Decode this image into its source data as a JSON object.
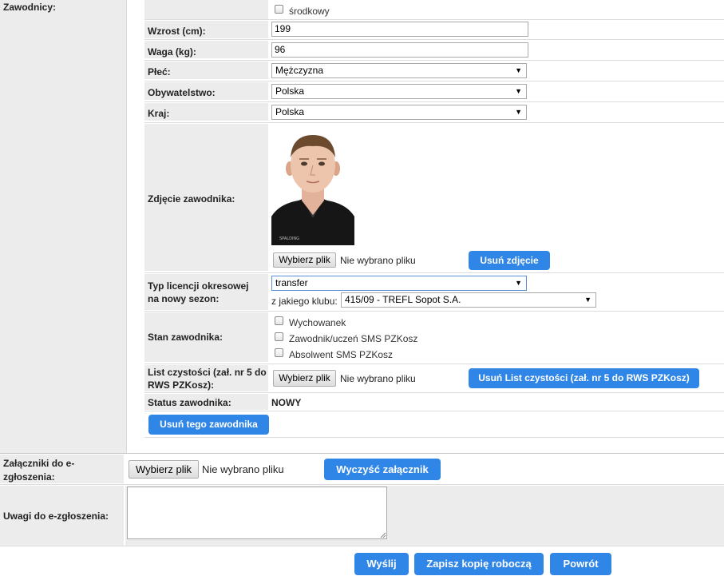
{
  "players_section": {
    "label": "Zawodnicy:"
  },
  "position": {
    "option": "środkowy"
  },
  "height": {
    "label": "Wzrost (cm):",
    "value": "199"
  },
  "weight": {
    "label": "Waga (kg):",
    "value": "96"
  },
  "gender": {
    "label": "Płeć:",
    "value": "Mężczyzna"
  },
  "citizenship": {
    "label": "Obywatelstwo:",
    "value": "Polska"
  },
  "country": {
    "label": "Kraj:",
    "value": "Polska"
  },
  "photo": {
    "label": "Zdjęcie zawodnika:",
    "choose_file": "Wybierz plik",
    "no_file": "Nie wybrano pliku",
    "remove_button": "Usuń zdjęcie",
    "jersey_text": "SPALDING"
  },
  "license": {
    "label_line1": "Typ licencji okresowej",
    "label_line2": "na nowy sezon:",
    "value": "transfer",
    "club_label": "z jakiego klubu:",
    "club_value": "415/09 - TREFL Sopot S.A."
  },
  "player_status_checks": {
    "label": "Stan zawodnika:",
    "options": [
      "Wychowanek",
      "Zawodnik/uczeń SMS PZKosz",
      "Absolwent SMS PZKosz"
    ]
  },
  "clearance_letter": {
    "label_line1": "List czystości (zał. nr 5 do",
    "label_line2": "RWS PZKosz):",
    "choose_file": "Wybierz plik",
    "no_file": "Nie wybrano pliku",
    "remove_button": "Usuń List czystości (zał. nr 5 do RWS PZKosz)"
  },
  "status": {
    "label": "Status zawodnika:",
    "value": "NOWY"
  },
  "remove_player_button": "Usuń tego zawodnika",
  "attachments": {
    "label_line1": "Załączniki do e-",
    "label_line2": "zgłoszenia:",
    "choose_file": "Wybierz plik",
    "no_file": "Nie wybrano pliku",
    "clear_button": "Wyczyść załącznik"
  },
  "remarks": {
    "label": "Uwagi do e-zgłoszenia:",
    "value": ""
  },
  "footer": {
    "send": "Wyślij",
    "save_draft": "Zapisz kopię roboczą",
    "back": "Powrót"
  },
  "colors": {
    "button": "#2f86e6",
    "label_bg": "#ececec"
  }
}
